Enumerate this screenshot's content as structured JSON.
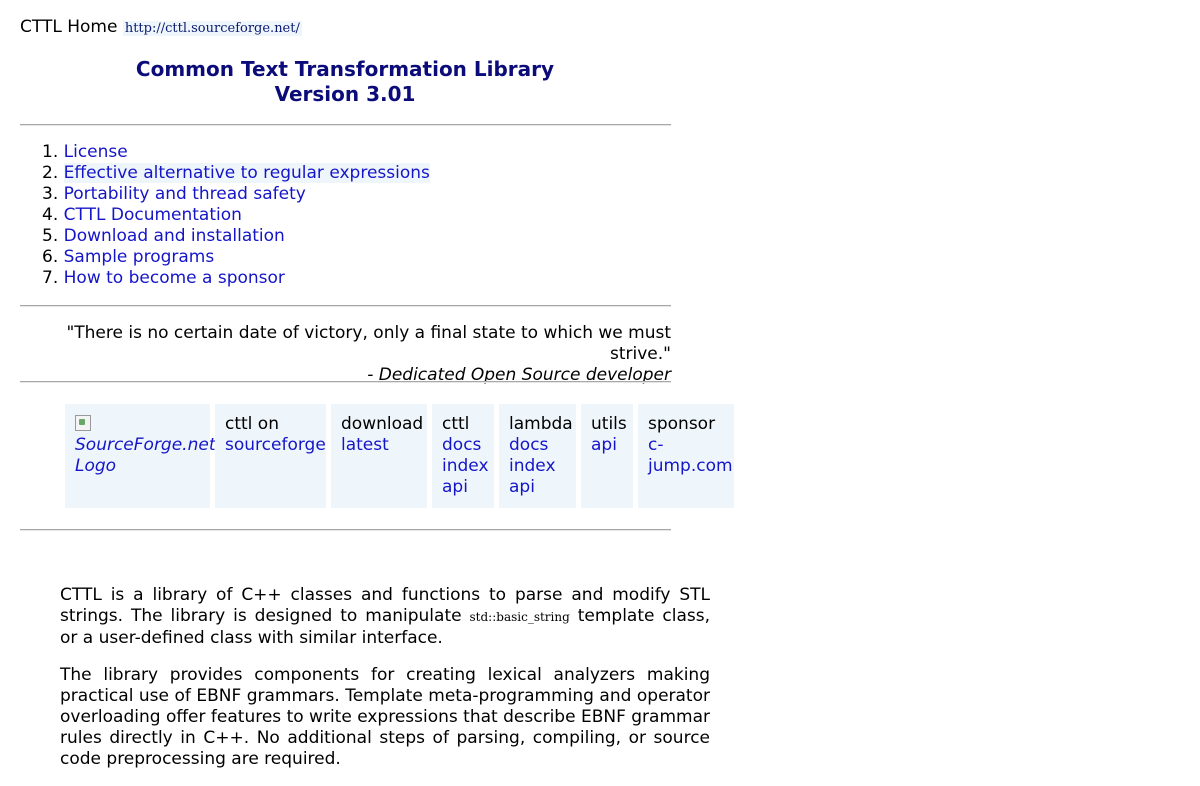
{
  "header": {
    "home_label": "CTTL Home",
    "home_url": "http://cttl.sourceforge.net/"
  },
  "title": {
    "line1": "Common Text Transformation Library",
    "line2": "Version 3.01"
  },
  "toc": [
    {
      "num": "1.",
      "label": "License"
    },
    {
      "num": "2.",
      "label": "Effective alternative to regular expressions"
    },
    {
      "num": "3.",
      "label": "Portability and thread safety"
    },
    {
      "num": "4.",
      "label": "CTTL Documentation"
    },
    {
      "num": "5.",
      "label": "Download and installation"
    },
    {
      "num": "6.",
      "label": "Sample programs"
    },
    {
      "num": "7.",
      "label": "How to become a sponsor"
    }
  ],
  "quote": {
    "text": "\"There is no certain date of victory, only a final state to which we must strive.\"",
    "attribution": "- Dedicated Open Source developer"
  },
  "navbar": {
    "logo_alt": "SourceForge.net Logo",
    "cells": [
      {
        "heading": "cttl on",
        "links": [
          "sourceforge"
        ]
      },
      {
        "heading": "download",
        "links": [
          "latest"
        ]
      },
      {
        "heading": "cttl",
        "links": [
          "docs",
          "index",
          "api"
        ]
      },
      {
        "heading": "lambda",
        "links": [
          "docs",
          "index",
          "api"
        ]
      },
      {
        "heading": "utils",
        "links": [
          "api"
        ]
      },
      {
        "heading": "sponsor",
        "links": [
          "c-",
          "jump.com"
        ]
      }
    ]
  },
  "content": {
    "p1_a": "CTTL is a library of C++ classes and functions to parse and modify STL strings. The library is designed to manipulate",
    "p1_code": "std::basic_string",
    "p1_b": "template class, or a user-defined class with similar interface.",
    "p2": "The library provides components for creating lexical analyzers making practical use of EBNF grammars. Template meta-programming and operator overloading offer features to write expressions that describe EBNF grammar rules directly in C++. No additional steps of parsing, compiling, or source code preprocessing are required."
  }
}
